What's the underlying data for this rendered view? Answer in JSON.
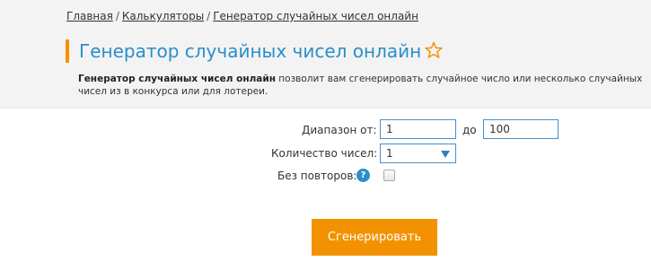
{
  "breadcrumb": {
    "items": [
      "Главная",
      "Калькуляторы",
      "Генератор случайных чисел онлайн"
    ],
    "separator": "/"
  },
  "header": {
    "title": "Генератор случайных чисел онлайн",
    "accent_color": "#f39200",
    "title_color": "#2a8ec9"
  },
  "description": {
    "bold": "Генератор случайных чисел онлайн",
    "text": " позволит вам сгенерировать случайное число или несколько случайных чисел из в конкурса или для лотереи."
  },
  "form": {
    "range_label": "Диапазон от:",
    "range_from": "1",
    "range_to_label": "до",
    "range_to": "100",
    "count_label": "Количество чисел:",
    "count_value": "1",
    "no_repeat_label": "Без повторов:",
    "help_icon_glyph": "?"
  },
  "button": {
    "generate_label": "Сгенерировать",
    "color": "#f39200"
  }
}
